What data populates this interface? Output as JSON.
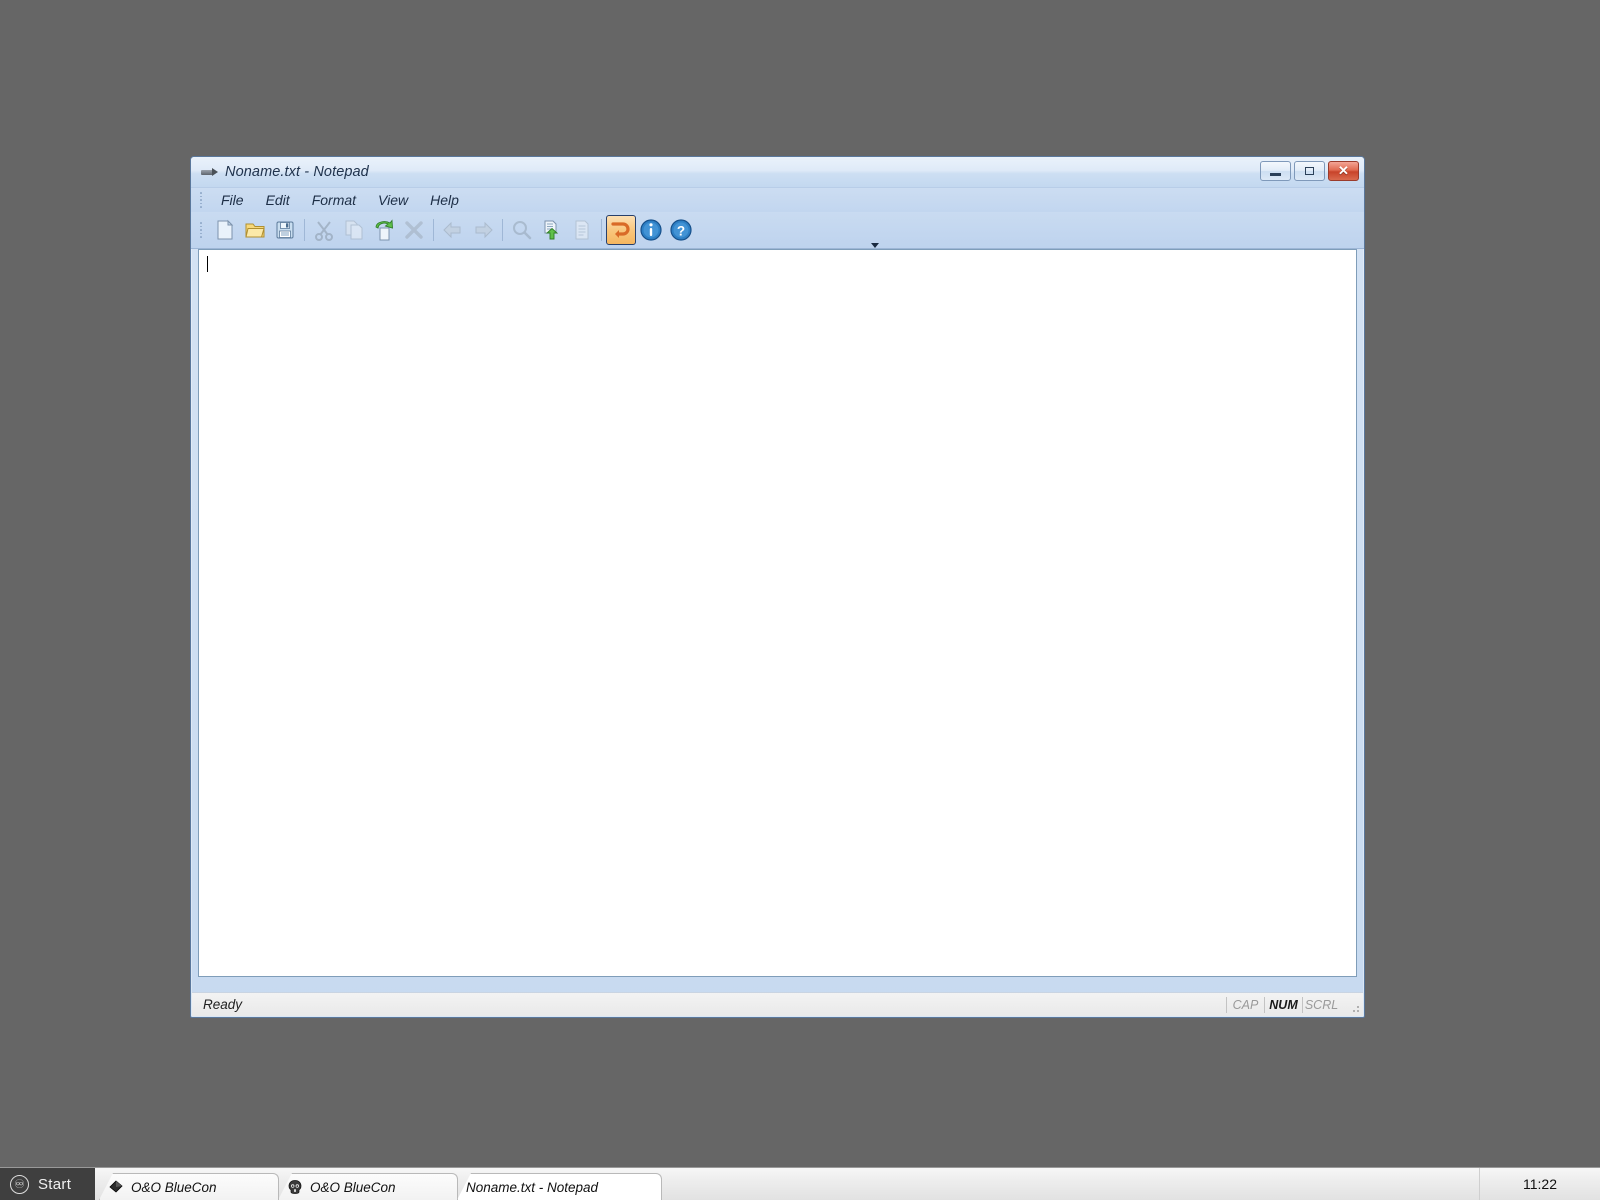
{
  "window": {
    "title": "Noname.txt - Notepad",
    "icon": "notepad-pen-icon",
    "controls": {
      "minimize_label": "–",
      "maximize_label": "□",
      "close_label": "✕"
    }
  },
  "menubar": {
    "items": [
      {
        "label": "File"
      },
      {
        "label": "Edit"
      },
      {
        "label": "Format"
      },
      {
        "label": "View"
      },
      {
        "label": "Help"
      }
    ]
  },
  "toolbar": {
    "buttons": [
      {
        "name": "new-file-icon",
        "tip": "New",
        "enabled": true,
        "active": false
      },
      {
        "name": "open-folder-icon",
        "tip": "Open",
        "enabled": true,
        "active": false
      },
      {
        "name": "save-disk-icon",
        "tip": "Save",
        "enabled": true,
        "active": false
      },
      {
        "name": "separator",
        "tip": "",
        "enabled": true,
        "active": false
      },
      {
        "name": "cut-scissors-icon",
        "tip": "Cut",
        "enabled": false,
        "active": false
      },
      {
        "name": "copy-icon",
        "tip": "Copy",
        "enabled": false,
        "active": false
      },
      {
        "name": "paste-icon",
        "tip": "Paste",
        "enabled": true,
        "active": false
      },
      {
        "name": "delete-x-icon",
        "tip": "Delete",
        "enabled": false,
        "active": false
      },
      {
        "name": "separator",
        "tip": "",
        "enabled": true,
        "active": false
      },
      {
        "name": "undo-arrow-icon",
        "tip": "Undo",
        "enabled": false,
        "active": false
      },
      {
        "name": "redo-arrow-icon",
        "tip": "Redo",
        "enabled": false,
        "active": false
      },
      {
        "name": "separator",
        "tip": "",
        "enabled": true,
        "active": false
      },
      {
        "name": "find-magnifier-icon",
        "tip": "Find",
        "enabled": false,
        "active": false
      },
      {
        "name": "replace-icon",
        "tip": "Replace",
        "enabled": true,
        "active": false
      },
      {
        "name": "page-setup-icon",
        "tip": "Page Setup",
        "enabled": false,
        "active": false
      },
      {
        "name": "separator",
        "tip": "",
        "enabled": true,
        "active": false
      },
      {
        "name": "word-wrap-icon",
        "tip": "Word Wrap",
        "enabled": true,
        "active": true
      },
      {
        "name": "info-icon",
        "tip": "About",
        "enabled": true,
        "active": false
      },
      {
        "name": "help-icon",
        "tip": "Help",
        "enabled": true,
        "active": false
      }
    ],
    "overflow_label": "▼"
  },
  "editor": {
    "content": "",
    "caret_visible": true
  },
  "statusbar": {
    "message": "Ready",
    "panes": [
      {
        "label": "CAP",
        "active": false
      },
      {
        "label": "NUM",
        "active": true
      },
      {
        "label": "SCRL",
        "active": false
      }
    ]
  },
  "taskbar": {
    "start_label": "Start",
    "start_icon": "swirl-logo-icon",
    "tasks": [
      {
        "label": "O&O BlueCon",
        "icon": "diamond-icon",
        "active": false
      },
      {
        "label": "O&O BlueCon",
        "icon": "skull-icon",
        "active": false
      },
      {
        "label": "Noname.txt - Notepad",
        "icon": "none",
        "active": true
      }
    ],
    "clock": "11:22"
  },
  "colors": {
    "desktop": "#666666",
    "window_frame": "#5b789c",
    "titlebar_top": "#eaf2fb",
    "titlebar_bottom": "#c3d8f0",
    "accent_active_toolbar": "#f5b65f",
    "close_button": "#c8432a",
    "taskbar_start_bg": "#3f3f3f"
  }
}
